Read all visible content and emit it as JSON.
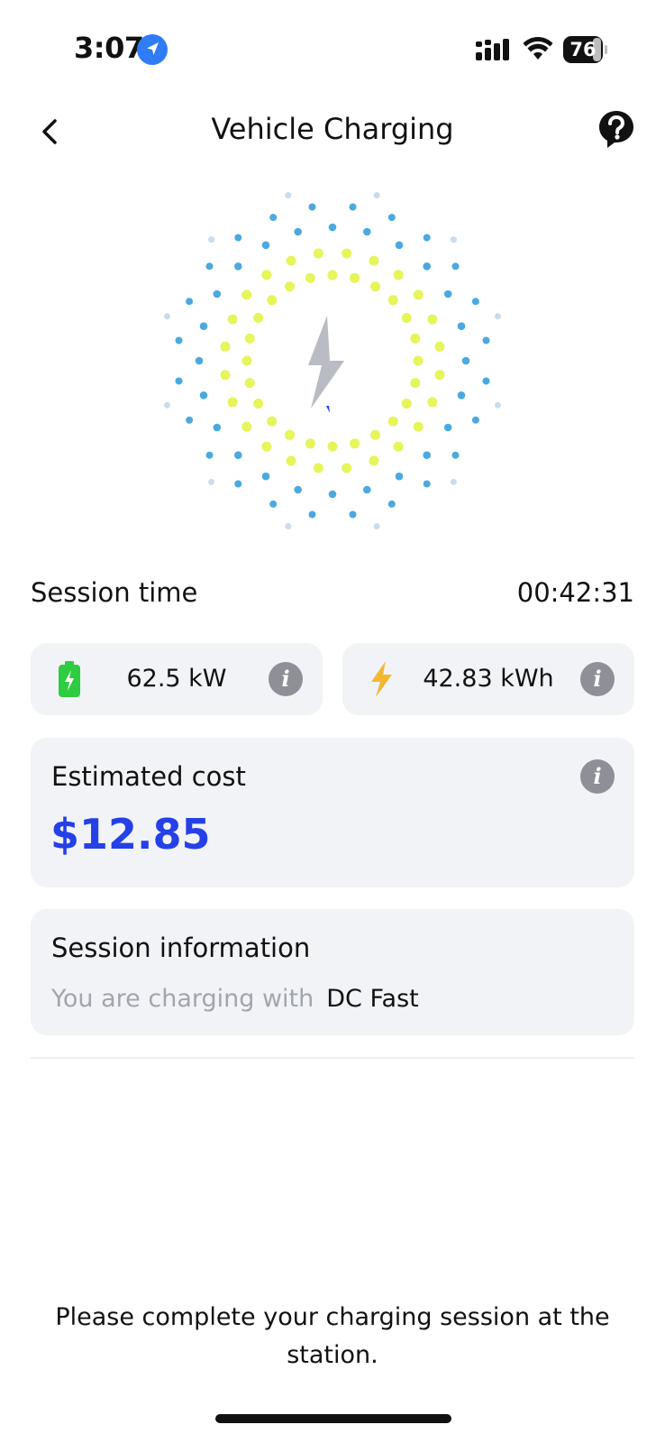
{
  "status_bar": {
    "time": "3:07",
    "battery_level": "76",
    "icons": [
      "location-arrow-icon",
      "cellular-signal-icon",
      "wifi-icon",
      "battery-icon"
    ]
  },
  "header": {
    "title": "Vehicle Charging",
    "back_icon": "chevron-left-icon",
    "help_icon": "help-icon"
  },
  "charging_graphic": {
    "icon": "lightning-bolt-icon",
    "colors": {
      "inner_dots": "#e5f55a",
      "middle_dots": "#4aa9e0",
      "outer_dots": "#c9dcec",
      "bolt": "#b9bcc2",
      "bolt_tip": "#2440e6"
    }
  },
  "session": {
    "time_label": "Session time",
    "time_value": "00:42:31"
  },
  "stats": {
    "power": {
      "value": "62.5 kW",
      "icon": "battery-charging-icon",
      "icon_color": "#2ecc40"
    },
    "energy": {
      "value": "42.83 kWh",
      "icon": "lightning-icon",
      "icon_color": "#f5b731"
    },
    "info_glyph": "i"
  },
  "cost": {
    "label": "Estimated cost",
    "value": "$12.85",
    "value_color": "#2440e6"
  },
  "session_info": {
    "title": "Session information",
    "prefix": "You are charging with",
    "charger_type": "DC Fast"
  },
  "footer": {
    "message": "Please complete your charging session at the station."
  }
}
